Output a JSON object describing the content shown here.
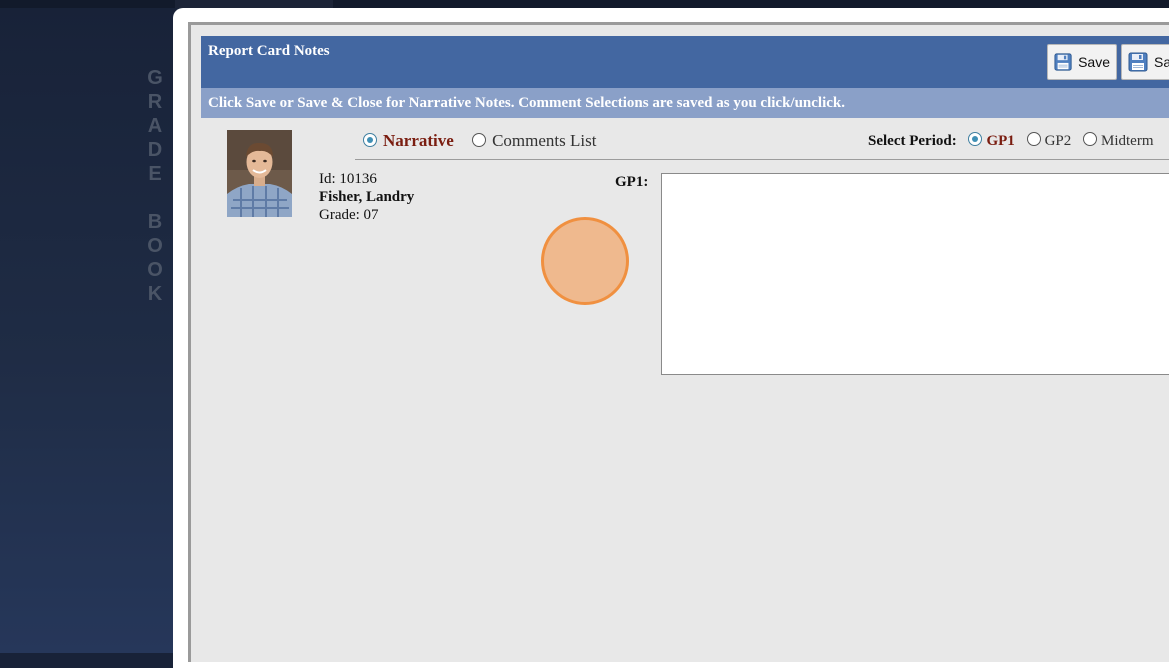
{
  "sidebar": {
    "vertical_label": [
      "G",
      "R",
      "A",
      "D",
      "E",
      "",
      "B",
      "O",
      "O",
      "K"
    ]
  },
  "dialog": {
    "title": "Report Card Notes",
    "buttons": {
      "save": "Save",
      "save_close": "Sa"
    },
    "instructions": "Click Save or Save & Close for Narrative Notes. Comment Selections are saved as you click/unclick."
  },
  "student": {
    "id_text": "Id: 10136",
    "name": "Fisher, Landry",
    "grade_text": "Grade: 07",
    "photo_icon": "student-photo"
  },
  "mode": {
    "options": [
      {
        "label": "Narrative",
        "selected": true
      },
      {
        "label": "Comments List",
        "selected": false
      }
    ]
  },
  "period": {
    "label": "Select Period:",
    "options": [
      {
        "label": "GP1",
        "selected": true
      },
      {
        "label": "GP2",
        "selected": false
      },
      {
        "label": "Midterm",
        "selected": false
      }
    ]
  },
  "narrative": {
    "field_label": "GP1:",
    "value": ""
  },
  "colors": {
    "header": "#4367a1",
    "instructions_bar": "#8aa0c8",
    "accent_text": "#7a1d10"
  }
}
